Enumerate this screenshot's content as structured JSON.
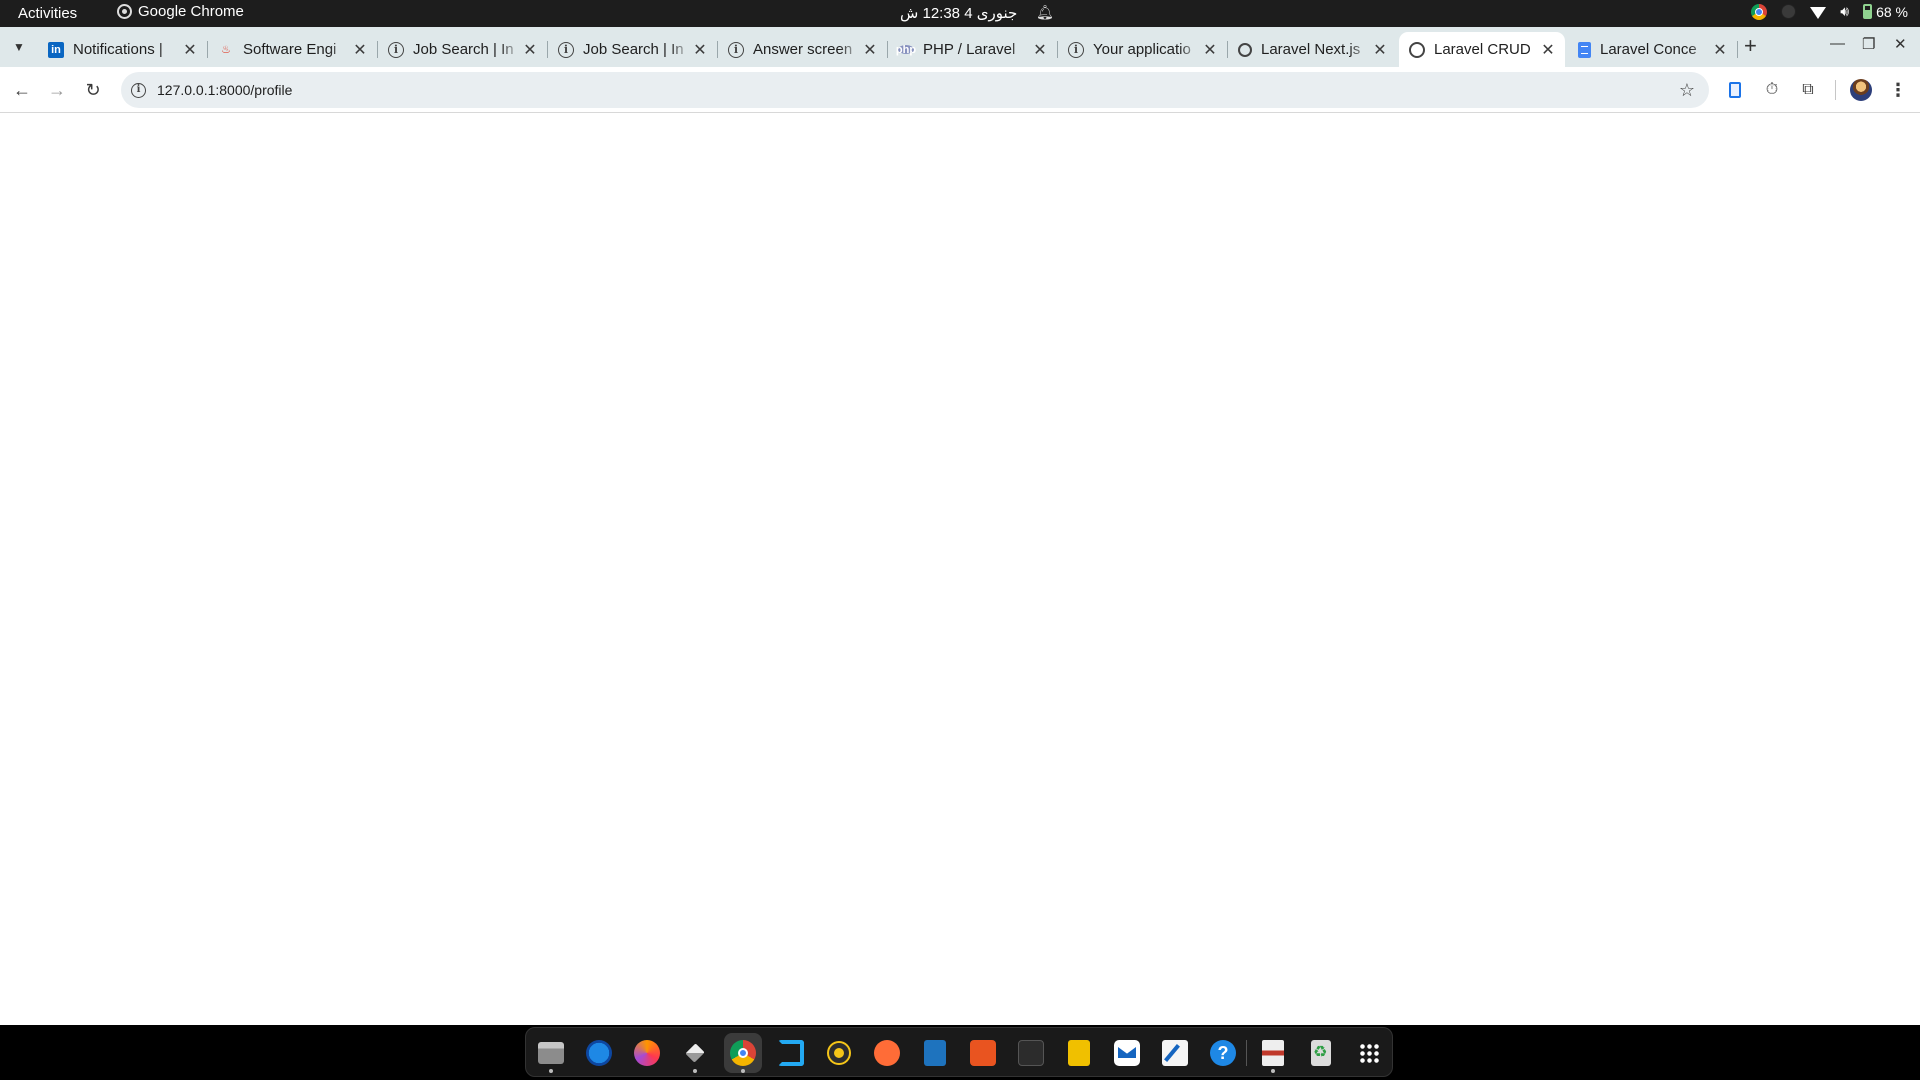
{
  "system_bar": {
    "activities": "Activities",
    "app_name": "Google Chrome",
    "clock": "جنوری 4  12:38 ش",
    "battery": "68 %",
    "icons": [
      "chrome-icon",
      "theme-icon",
      "wifi-icon",
      "volume-icon",
      "battery-icon",
      "bell-icon"
    ]
  },
  "browser": {
    "tabs": [
      {
        "title": "Notifications |",
        "icon": "linkedin-icon"
      },
      {
        "title": "Software Engi",
        "icon": "flame-icon"
      },
      {
        "title": "Job Search | In",
        "icon": "info-icon"
      },
      {
        "title": "Job Search | In",
        "icon": "info-icon"
      },
      {
        "title": "Answer screen",
        "icon": "info-icon"
      },
      {
        "title": "PHP / Laravel",
        "icon": "php-icon"
      },
      {
        "title": "Your applicatio",
        "icon": "info-icon"
      },
      {
        "title": "Laravel Next.js",
        "icon": "openai-icon"
      },
      {
        "title": "Laravel CRUD",
        "icon": "globe-icon",
        "active": true
      },
      {
        "title": "Laravel Conce",
        "icon": "docs-icon"
      }
    ],
    "close_glyph": "✕",
    "new_tab_glyph": "+",
    "url": "127.0.0.1:8000/profile"
  },
  "dock": {
    "apps": [
      "files",
      "thunderbird",
      "firefox",
      "package-manager",
      "chrome",
      "vscode",
      "rhythmbox",
      "postman",
      "writer",
      "software-center",
      "terminal",
      "calculator",
      "mail",
      "text-editor",
      "help",
      "image-viewer",
      "trash",
      "app-grid"
    ]
  },
  "colors": {
    "top_bar": "#1d1d1d",
    "tab_strip": "#dfe8ea",
    "omnibox": "#e9eef1",
    "dock": "#1a1a1a"
  }
}
